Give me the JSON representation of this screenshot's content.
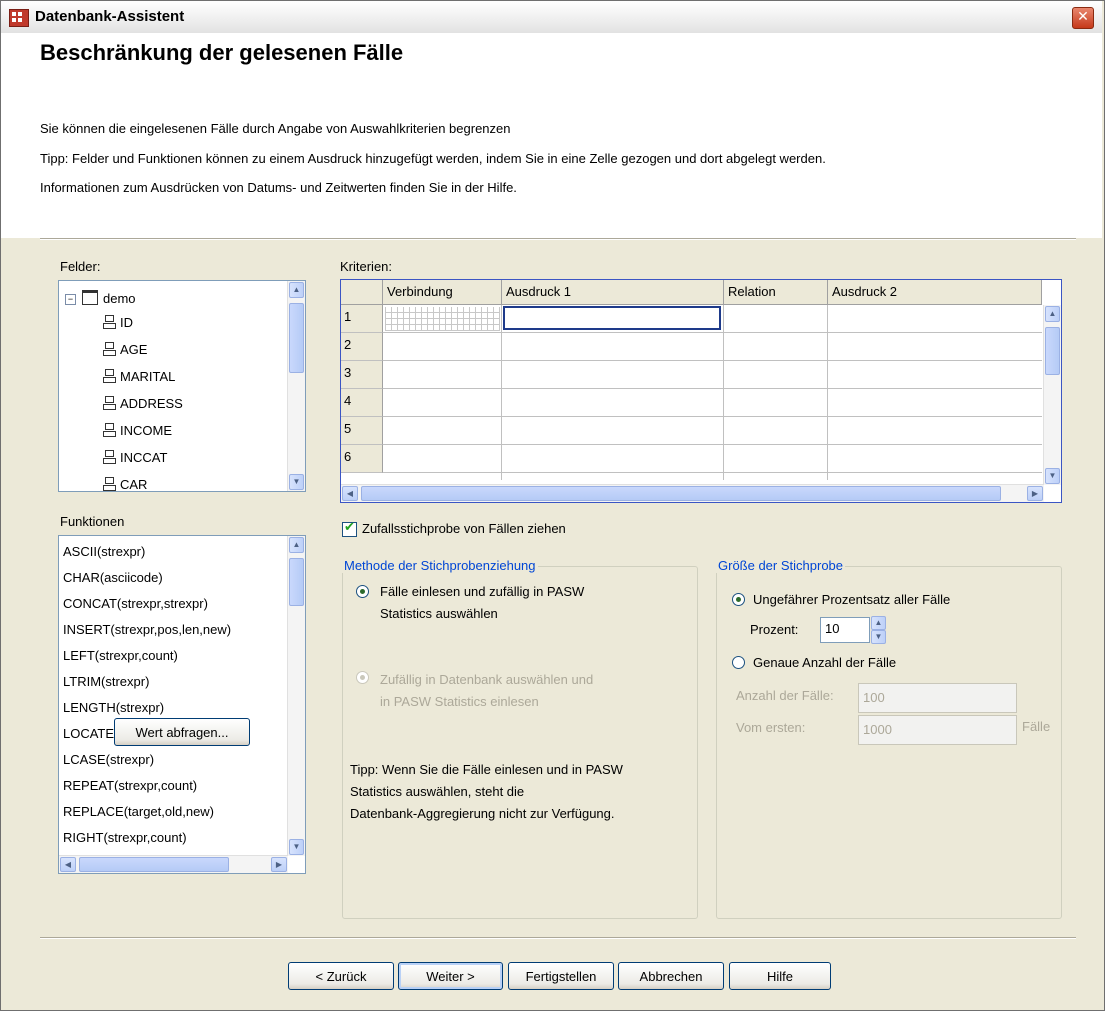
{
  "window": {
    "title": "Datenbank-Assistent",
    "close_icon": "close-icon"
  },
  "header": {
    "title": "Beschränkung der gelesenen Fälle",
    "lines": [
      "Sie können die eingelesenen Fälle durch Angabe von Auswahlkriterien begrenzen",
      "Tipp: Felder und Funktionen können zu einem Ausdruck hinzugefügt werden, indem Sie in eine  Zelle gezogen und dort abgelegt werden.",
      "Informationen zum Ausdrücken von Datums- und Zeitwerten finden Sie in der Hilfe."
    ]
  },
  "fields": {
    "label": "Felder:",
    "root": "demo",
    "items": [
      "ID",
      "AGE",
      "MARITAL",
      "ADDRESS",
      "INCOME",
      "INCCAT",
      "CAR"
    ]
  },
  "functions": {
    "label": "Funktionen",
    "items": [
      "ASCII(strexpr)",
      "CHAR(asciicode)",
      "CONCAT(strexpr,strexpr)",
      "INSERT(strexpr,pos,len,new)",
      "LEFT(strexpr,count)",
      "LTRIM(strexpr)",
      "LENGTH(strexpr)",
      "LOCATE(haystack,needle)",
      "LCASE(strexpr)",
      "REPEAT(strexpr,count)",
      "REPLACE(target,old,new)",
      "RIGHT(strexpr,count)"
    ],
    "query_button": "Wert abfragen..."
  },
  "criteria": {
    "label": "Kriterien:",
    "columns": [
      "Verbindung",
      "Ausdruck 1",
      "Relation",
      "Ausdruck 2"
    ],
    "rows": [
      "1",
      "2",
      "3",
      "4",
      "5",
      "6"
    ]
  },
  "random_sample": {
    "label": "Zufallsstichprobe von Fällen ziehen",
    "checked": true
  },
  "method_group": {
    "title": "Methode der Stichprobenziehung",
    "option1_line1": "Fälle einlesen und zufällig in PASW",
    "option1_line2": "Statistics auswählen",
    "option2_line1": "Zufällig in Datenbank auswählen und",
    "option2_line2": "in PASW Statistics einlesen",
    "tip_line1": "Tipp: Wenn Sie die Fälle einlesen und in PASW",
    "tip_line2": "Statistics auswählen, steht die",
    "tip_line3": "Datenbank-Aggregierung nicht zur Verfügung."
  },
  "size_group": {
    "title": "Größe der Stichprobe",
    "approx_label": "Ungefährer Prozentsatz aller Fälle",
    "percent_label": "Prozent:",
    "percent_value": "10",
    "exact_label": "Genaue Anzahl der Fälle",
    "count_label": "Anzahl der Fälle:",
    "count_value": "100",
    "from_label": "Vom ersten:",
    "from_value": "1000",
    "cases_suffix": "Fälle"
  },
  "buttons": {
    "back": "< Zurück",
    "next": "Weiter >",
    "finish": "Fertigstellen",
    "cancel": "Abbrechen",
    "help": "Hilfe"
  }
}
